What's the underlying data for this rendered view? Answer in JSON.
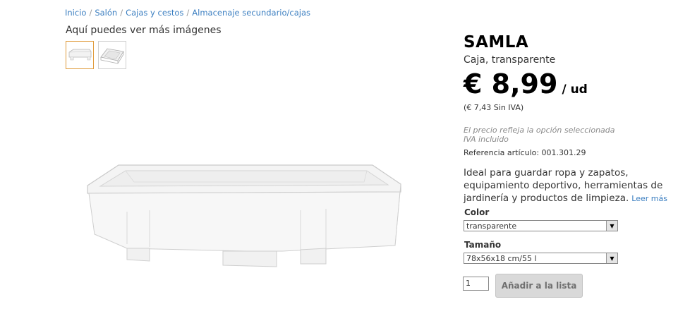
{
  "breadcrumb": {
    "items": [
      "Inicio",
      "Salón",
      "Cajas y cestos",
      "Almacenaje secundario/cajas"
    ],
    "separator": "/"
  },
  "gallery": {
    "more_images_label": "Aquí puedes ver más imágenes"
  },
  "product": {
    "name": "SAMLA",
    "subtitle": "Caja, transparente",
    "price": "€ 8,99",
    "price_unit": "/ ud",
    "price_no_vat": "(€ 7,43 Sin IVA)",
    "price_note_line1": "El precio refleja la opción seleccionada",
    "price_note_line2": "IVA incluido",
    "reference": "Referencia artículo: 001.301.29",
    "description": "Ideal para guardar ropa y zapatos, equipamiento deportivo, herramientas de jardinería y productos de limpieza.",
    "read_more": "Leer más"
  },
  "options": {
    "color_label": "Color",
    "color_value": "transparente",
    "size_label": "Tamaño",
    "size_value": "78x56x18 cm/55 l"
  },
  "purchase": {
    "quantity": "1",
    "add_button": "Añadir a la lista"
  },
  "colors": {
    "link": "#3c7fc1",
    "thumb_selected_border": "#e09a3a",
    "button_bg": "#d9d9d9"
  }
}
